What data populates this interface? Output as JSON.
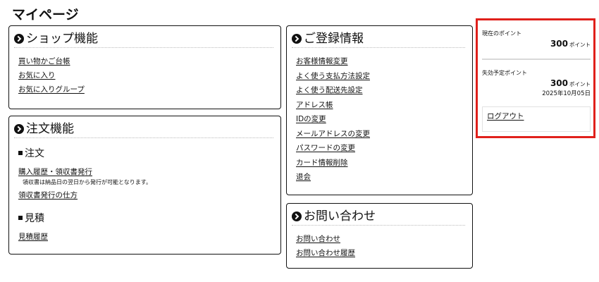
{
  "page": {
    "title": "マイページ"
  },
  "shop": {
    "title": "ショップ機能",
    "links": [
      "買い物かご台帳",
      "お気に入り",
      "お気に入りグループ"
    ]
  },
  "order": {
    "title": "注文機能",
    "section_order": "注文",
    "history_link": "購入履歴・領収書発行",
    "history_note": "領収書は納品日の翌日から発行が可能となります。",
    "receipt_howto_link": "領収書発行の仕方",
    "section_estimate": "見積",
    "estimate_history_link": "見積履歴"
  },
  "registration": {
    "title": "ご登録情報",
    "links": [
      "お客様情報変更",
      "よく使う支払方法設定",
      "よく使う配送先設定",
      "アドレス帳",
      "IDの変更",
      "メールアドレスの変更",
      "パスワードの変更",
      "カード情報削除",
      "退会"
    ]
  },
  "contact": {
    "title": "お問い合わせ",
    "links": [
      "お問い合わせ",
      "お問い合わせ履歴"
    ]
  },
  "points": {
    "current_label": "現在のポイント",
    "current_value": "300",
    "unit": "ポイント",
    "expiring_label": "失効予定ポイント",
    "expiring_value": "300",
    "expiring_date": "2025年10月05日",
    "logout_label": "ログアウト",
    "highlight_color": "#e0201b"
  }
}
